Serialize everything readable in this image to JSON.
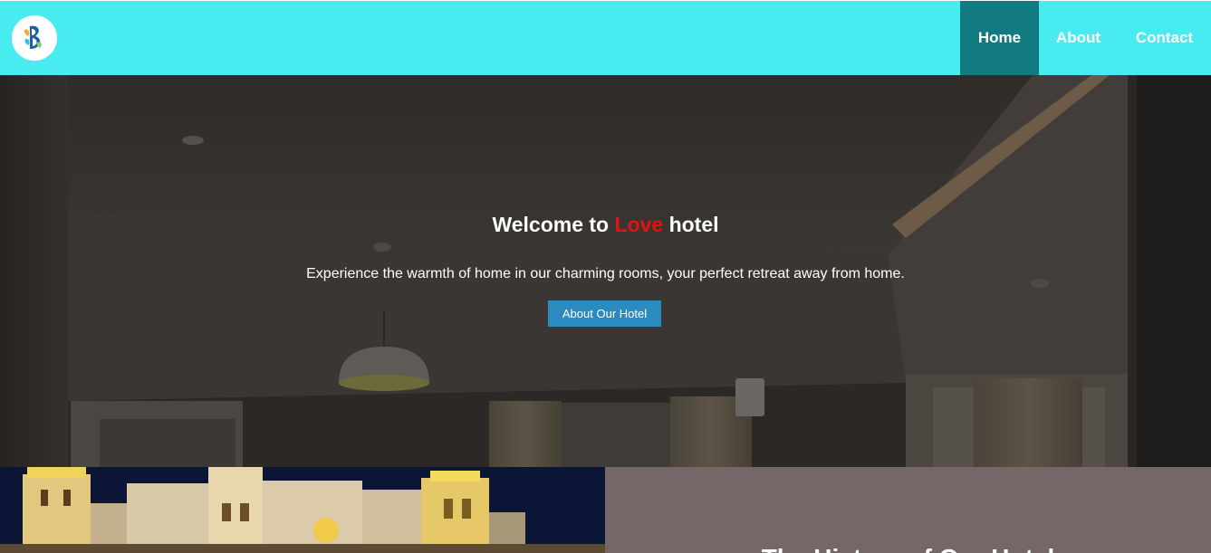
{
  "navbar": {
    "logo_icon": "hotel-logo-icon",
    "links": [
      {
        "label": "Home",
        "active": true
      },
      {
        "label": "About",
        "active": false
      },
      {
        "label": "Contact",
        "active": false
      }
    ],
    "background": "#48ecf0",
    "active_background": "#127b82"
  },
  "hero": {
    "title_prefix": "Welcome to ",
    "title_accent": "Love",
    "title_suffix": " hotel",
    "subtitle": "Experience the warmth of home in our charming rooms, your perfect retreat away from home.",
    "button_label": "About Our Hotel",
    "accent_color": "#e31212",
    "button_color": "#2b8bbf"
  },
  "lower": {
    "image": "hotel-building-night-image",
    "heading": "The History of Our Hotel",
    "panel_color": "#756767"
  }
}
